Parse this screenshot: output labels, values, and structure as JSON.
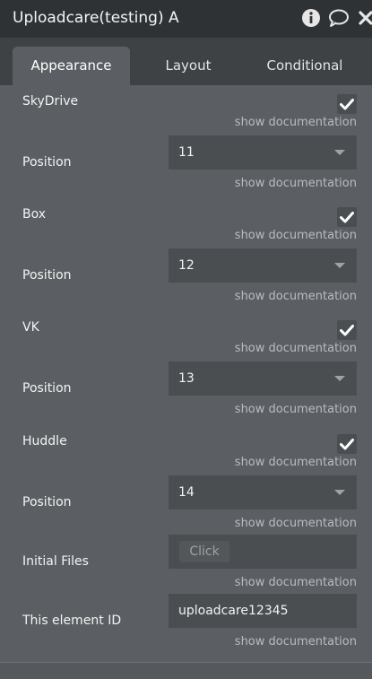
{
  "header": {
    "title": "Uploadcare(testing) A",
    "icons": [
      "info-icon",
      "comment-icon",
      "close-icon"
    ]
  },
  "tabs": [
    {
      "label": "Appearance",
      "active": true
    },
    {
      "label": "Layout",
      "active": false
    },
    {
      "label": "Conditional",
      "active": false
    }
  ],
  "doc_link": "show documentation",
  "fields": {
    "skydrive": {
      "label": "SkyDrive",
      "checked": true
    },
    "skydrive_position": {
      "label": "Position",
      "value": "11"
    },
    "box": {
      "label": "Box",
      "checked": true
    },
    "box_position": {
      "label": "Position",
      "value": "12"
    },
    "vk": {
      "label": "VK",
      "checked": true
    },
    "vk_position": {
      "label": "Position",
      "value": "13"
    },
    "huddle": {
      "label": "Huddle",
      "checked": true
    },
    "huddle_position": {
      "label": "Position",
      "value": "14"
    },
    "initial_files": {
      "label": "Initial Files",
      "button": "Click"
    },
    "element_id": {
      "label": "This element ID",
      "value": "uploadcare12345"
    }
  },
  "colors": {
    "panel": "#5b5f63",
    "header": "#2f3235",
    "tabbar": "#3e4245",
    "field": "#4a4e51",
    "muted_text": "#b8bcbf"
  }
}
